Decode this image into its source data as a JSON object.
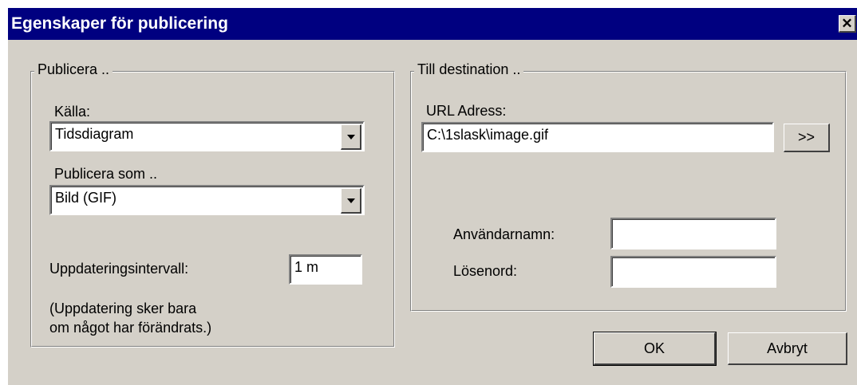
{
  "dialog": {
    "title": "Egenskaper för publicering",
    "close_symbol": "✕"
  },
  "publish_group": {
    "legend": "Publicera ..",
    "source_label": "Källa:",
    "source_value": "Tidsdiagram",
    "publish_as_label": "Publicera som ..",
    "publish_as_value": "Bild (GIF)",
    "interval_label": "Uppdateringsintervall:",
    "interval_value": "1 m",
    "note_line1": "(Uppdatering sker bara",
    "note_line2": "om något har förändrats.)"
  },
  "destination_group": {
    "legend": "Till destination ..",
    "url_label": "URL Adress:",
    "url_value": "C:\\1slask\\image.gif",
    "browse_label": ">>",
    "username_label": "Användarnamn:",
    "username_value": "",
    "password_label": "Lösenord:",
    "password_value": ""
  },
  "buttons": {
    "ok": "OK",
    "cancel": "Avbryt"
  }
}
